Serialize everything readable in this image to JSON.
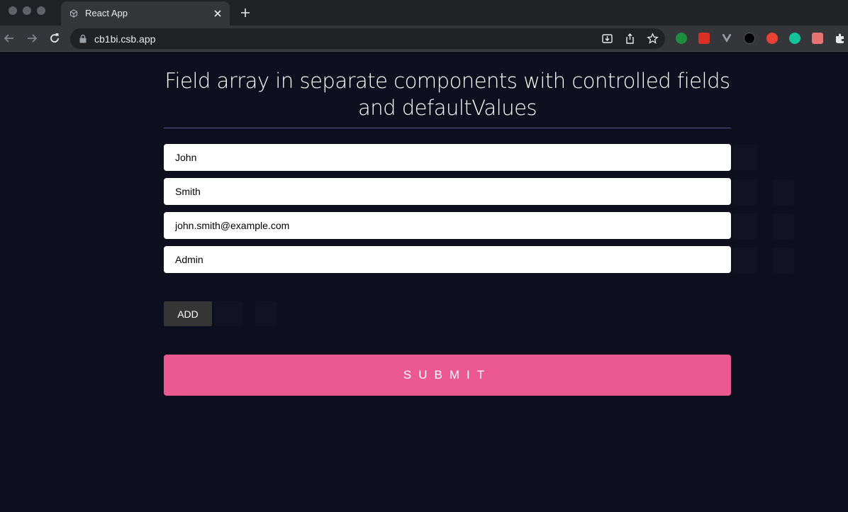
{
  "browser": {
    "tab_title": "React App",
    "url": "cb1bi.csb.app",
    "extension_colors": [
      "#1e8e3e",
      "#d93025",
      "#9aa0a6",
      "#ffffff",
      "#ea4335",
      "#15c39a",
      "#e57373"
    ]
  },
  "page": {
    "title": "Field array in separate components with controlled fields and defaultValues",
    "fields": [
      {
        "value": "John"
      },
      {
        "value": "Smith"
      },
      {
        "value": "john.smith@example.com"
      },
      {
        "value": "Admin"
      }
    ],
    "add_label": "ADD",
    "submit_label": "submit"
  },
  "colors": {
    "background": "#0d0f1e",
    "submit": "#ec5990",
    "add_button": "#353535"
  }
}
